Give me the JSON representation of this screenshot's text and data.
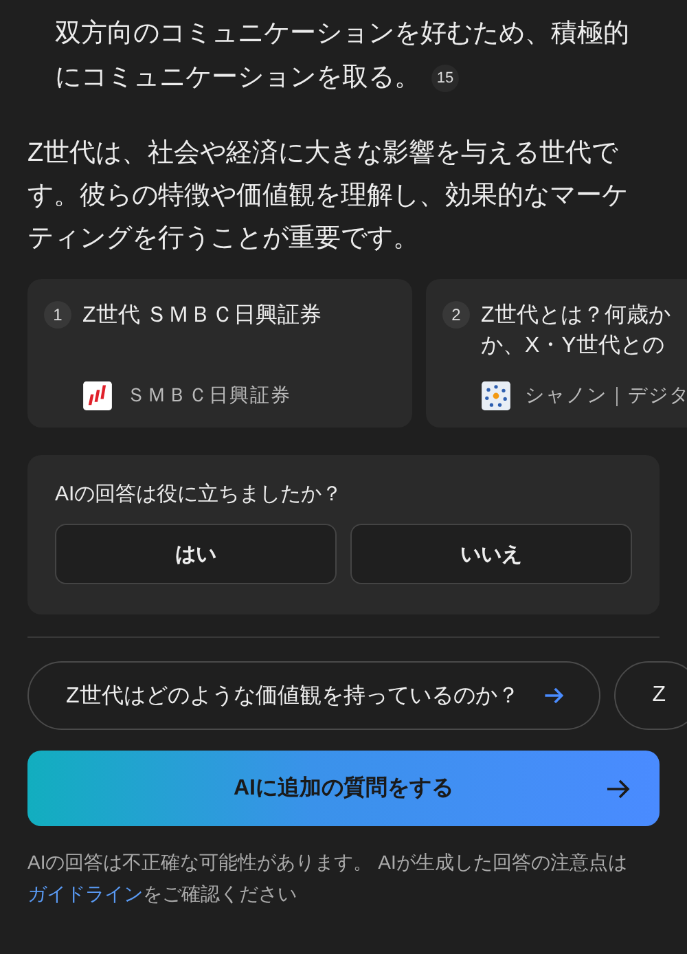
{
  "list_item": {
    "text": "双方向のコミュニケーションを好むため、積極的にコミュニケーションを取る。",
    "citation": "15"
  },
  "summary": "Z世代は、社会や経済に大きな影響を与える世代です。彼らの特徴や価値観を理解し、効果的なマーケティングを行うことが重要です。",
  "sources": [
    {
      "number": "1",
      "title_lines": [
        "Z世代 ＳＭＢＣ日興証券"
      ],
      "site": "ＳＭＢＣ日興証券",
      "kind": "bars"
    },
    {
      "number": "2",
      "title_lines": [
        "Z世代とは？何歳か",
        "か、X・Y世代との"
      ],
      "site": "シャノン｜デジタ",
      "kind": "dots"
    }
  ],
  "feedback": {
    "question": "AIの回答は役に立ちましたか？",
    "buttons": [
      "はい",
      "いいえ"
    ]
  },
  "suggestions": [
    {
      "text": "Z世代はどのような価値観を持っているのか？",
      "arrow": true
    },
    {
      "text": "Z",
      "arrow": false
    }
  ],
  "ask_button": "AIに追加の質問をする",
  "disclaimer": {
    "before": "AIの回答は不正確な可能性があります。 AIが生成した回答の注意点は",
    "link": "ガイドライン",
    "after": "をご確認ください"
  }
}
